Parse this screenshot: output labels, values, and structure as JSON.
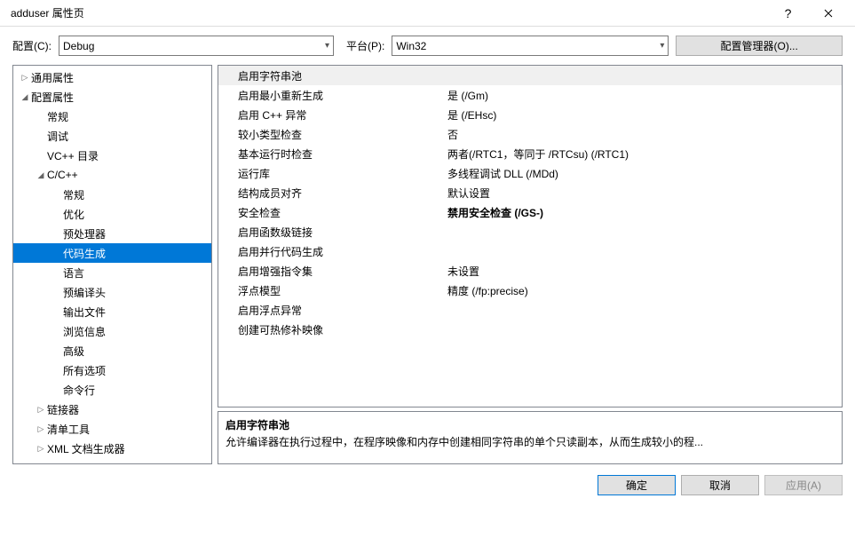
{
  "title": "adduser 属性页",
  "top": {
    "config_label": "配置(C):",
    "config_value": "Debug",
    "platform_label": "平台(P):",
    "platform_value": "Win32",
    "mgr_button": "配置管理器(O)..."
  },
  "tree": [
    {
      "label": "通用属性",
      "indent": 0,
      "expand": "▷"
    },
    {
      "label": "配置属性",
      "indent": 0,
      "expand": "◢"
    },
    {
      "label": "常规",
      "indent": 1,
      "expand": ""
    },
    {
      "label": "调试",
      "indent": 1,
      "expand": ""
    },
    {
      "label": "VC++ 目录",
      "indent": 1,
      "expand": ""
    },
    {
      "label": "C/C++",
      "indent": 1,
      "expand": "◢"
    },
    {
      "label": "常规",
      "indent": 2,
      "expand": ""
    },
    {
      "label": "优化",
      "indent": 2,
      "expand": ""
    },
    {
      "label": "预处理器",
      "indent": 2,
      "expand": ""
    },
    {
      "label": "代码生成",
      "indent": 2,
      "expand": "",
      "selected": true
    },
    {
      "label": "语言",
      "indent": 2,
      "expand": ""
    },
    {
      "label": "预编译头",
      "indent": 2,
      "expand": ""
    },
    {
      "label": "输出文件",
      "indent": 2,
      "expand": ""
    },
    {
      "label": "浏览信息",
      "indent": 2,
      "expand": ""
    },
    {
      "label": "高级",
      "indent": 2,
      "expand": ""
    },
    {
      "label": "所有选项",
      "indent": 2,
      "expand": ""
    },
    {
      "label": "命令行",
      "indent": 2,
      "expand": ""
    },
    {
      "label": "链接器",
      "indent": 1,
      "expand": "▷"
    },
    {
      "label": "清单工具",
      "indent": 1,
      "expand": "▷"
    },
    {
      "label": "XML 文档生成器",
      "indent": 1,
      "expand": "▷"
    }
  ],
  "grid": [
    {
      "key": "启用字符串池",
      "val": "",
      "sel": true
    },
    {
      "key": "启用最小重新生成",
      "val": "是 (/Gm)"
    },
    {
      "key": "启用 C++ 异常",
      "val": "是 (/EHsc)"
    },
    {
      "key": "较小类型检查",
      "val": "否"
    },
    {
      "key": "基本运行时检查",
      "val": "两者(/RTC1，等同于 /RTCsu) (/RTC1)"
    },
    {
      "key": "运行库",
      "val": "多线程调试 DLL (/MDd)"
    },
    {
      "key": "结构成员对齐",
      "val": "默认设置"
    },
    {
      "key": "安全检查",
      "val": "禁用安全检查 (/GS-)",
      "bold": true
    },
    {
      "key": "启用函数级链接",
      "val": ""
    },
    {
      "key": "启用并行代码生成",
      "val": ""
    },
    {
      "key": "启用增强指令集",
      "val": "未设置"
    },
    {
      "key": "浮点模型",
      "val": "精度 (/fp:precise)"
    },
    {
      "key": "启用浮点异常",
      "val": ""
    },
    {
      "key": "创建可热修补映像",
      "val": ""
    }
  ],
  "desc": {
    "title": "启用字符串池",
    "text": "允许编译器在执行过程中，在程序映像和内存中创建相同字符串的单个只读副本，从而生成较小的程..."
  },
  "footer": {
    "ok": "确定",
    "cancel": "取消",
    "apply": "应用(A)"
  }
}
